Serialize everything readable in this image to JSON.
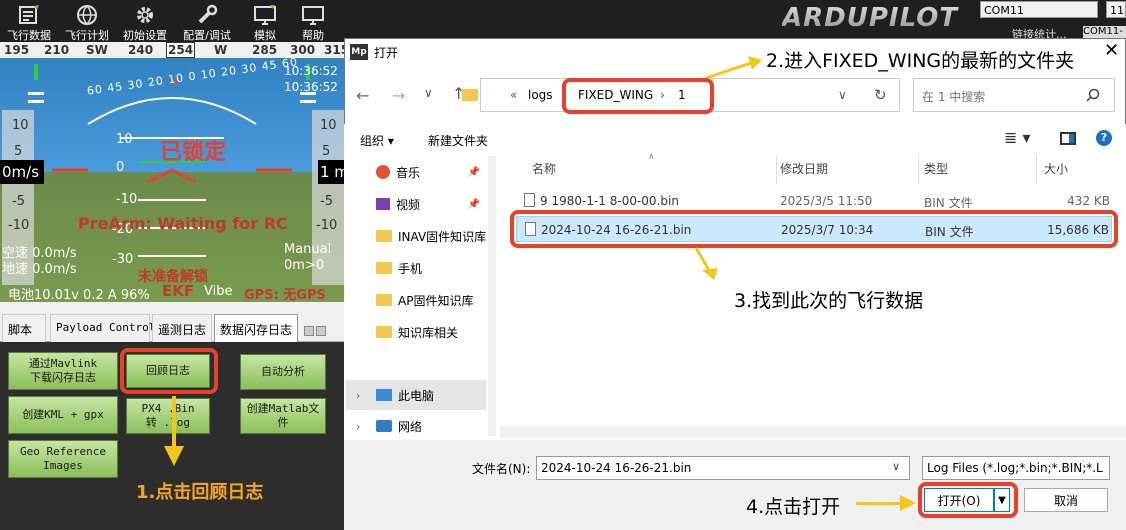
{
  "toolbar": {
    "items": [
      {
        "label": "飞行数据",
        "icon": "flight-data-icon"
      },
      {
        "label": "飞行计划",
        "icon": "globe-icon"
      },
      {
        "label": "初始设置",
        "icon": "gear-icon"
      },
      {
        "label": "配置/调试",
        "icon": "wrench-icon"
      },
      {
        "label": "模拟",
        "icon": "monitor-icon"
      },
      {
        "label": "帮助",
        "icon": "help-monitor-icon"
      }
    ],
    "logo": "ARDUPILOT",
    "com_port": "COM11",
    "baud": "115",
    "link_stats": "链接统计...",
    "com_port2": "COM11-"
  },
  "hud": {
    "compass": [
      "195",
      "210",
      "SW",
      "240",
      "254",
      "W",
      "285",
      "300",
      "315"
    ],
    "heading_value": "254",
    "time1": "10:36:52",
    "time2": "10:36:52",
    "locked": "已锁定",
    "prearm": "PreArm: Waiting for RC",
    "left_speed": "0m/s",
    "right_alt": "1 m",
    "left_scale": [
      "10",
      "5",
      "0",
      "-5",
      "-10"
    ],
    "right_scale": [
      "10",
      "5",
      "0",
      "-5",
      "-10"
    ],
    "pitch_labels": [
      "10",
      "0",
      "-10",
      "-20",
      "-30"
    ],
    "roll_scale": "60 45 30 20 10 0 10 20 30 45 60",
    "airspeed": "空速 0.0m/s",
    "groundspeed": "地速 0.0m/s",
    "mode": "Manual",
    "mode_sub": "0m>0",
    "not_armed": "未准备解锁",
    "battery": "电池10.01v 0.2 A 96%",
    "ekf": "EKF",
    "vibe": "Vibe",
    "gps": "GPS: 无GPS"
  },
  "tabs": [
    "脚本",
    "Payload Control",
    "遥测日志",
    "数据闪存日志"
  ],
  "panel_buttons": {
    "download": "通过Mavlink\n下载闪存日志",
    "review": "回顾日志",
    "auto": "自动分析",
    "kml": "创建KML + gpx",
    "px4": "PX4 .Bin\n转 .log",
    "matlab": "创建Matlab文\n件",
    "geo": "Geo Reference\nImages"
  },
  "annotations": {
    "step1": "1.点击回顾日志",
    "step2": "2.进入FIXED_WING的最新的文件夹",
    "step3": "3.找到此次的飞行数据",
    "step4": "4.点击打开"
  },
  "dialog": {
    "icon": "Mp",
    "title": "打开",
    "breadcrumb": [
      "«",
      "logs",
      "FIXED_WING",
      "1"
    ],
    "search_placeholder": "在 1 中搜索",
    "organize": "组织 ▾",
    "new_folder": "新建文件夹",
    "nav": [
      {
        "label": "音乐",
        "icon": "music-icon",
        "pinned": true
      },
      {
        "label": "视频",
        "icon": "video-icon",
        "pinned": true
      },
      {
        "label": "INAV固件知识库",
        "icon": "folder-icon"
      },
      {
        "label": "手机",
        "icon": "folder-icon"
      },
      {
        "label": "AP固件知识库",
        "icon": "folder-icon"
      },
      {
        "label": "知识库相关",
        "icon": "folder-icon"
      },
      {
        "label": "此电脑",
        "icon": "computer-icon"
      },
      {
        "label": "网络",
        "icon": "network-icon"
      }
    ],
    "columns": [
      "名称",
      "修改日期",
      "类型",
      "大小"
    ],
    "files": [
      {
        "name": "9 1980-1-1 8-00-00.bin",
        "date": "2025/3/5 11:50",
        "type": "BIN 文件",
        "size": "432 KB"
      },
      {
        "name": "2024-10-24 16-26-21.bin",
        "date": "2025/3/7 10:34",
        "type": "BIN 文件",
        "size": "15,686 KB"
      }
    ],
    "filename_label": "文件名(N):",
    "filename": "2024-10-24 16-26-21.bin",
    "filter": "Log Files (*.log;*.bin;*.BIN;*.L",
    "open": "打开(O)",
    "cancel": "取消"
  },
  "colors": {
    "highlight_red": "#e8402a",
    "annotation_yellow": "#f5c518",
    "selection": "#cce8ff"
  }
}
